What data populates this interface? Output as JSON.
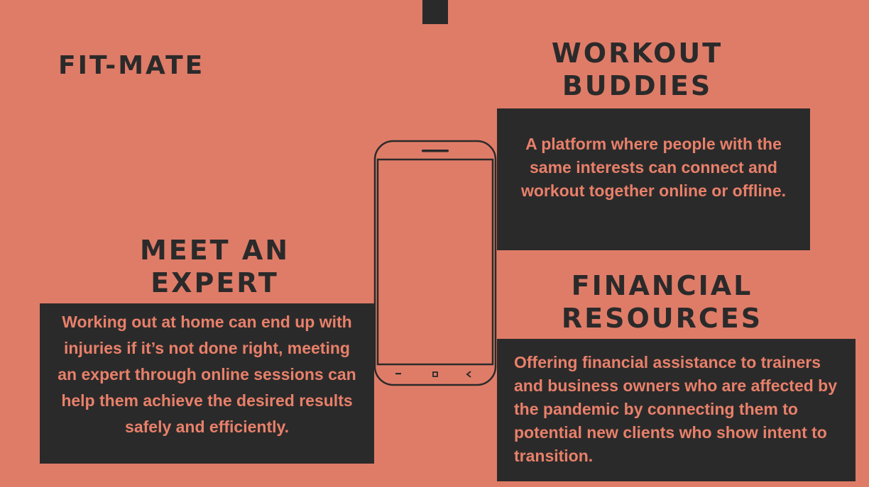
{
  "slide": {
    "background": "#df7c68",
    "dark": "#2b2a2a",
    "accent_text": "#e8806a"
  },
  "brand": {
    "title": "FIT-MATE"
  },
  "sections": {
    "workout": {
      "title": "WORKOUT BUDDIES",
      "body": "A platform where people with the same interests can connect and workout together online or offline."
    },
    "expert": {
      "title": "MEET AN EXPERT",
      "body": "Working out at home can end up with injuries if it’s not done right, meeting an expert through online sessions can help them achieve the desired results safely and efficiently."
    },
    "financial": {
      "title": "FINANCIAL RESOURCES",
      "body": "Offering financial assistance to trainers and business owners  who are affected by the pandemic by connecting them to potential new clients who show intent to transition."
    }
  },
  "icons": {
    "phone": "smartphone-outline-icon",
    "nav_recent": "minus-icon",
    "nav_home": "square-icon",
    "nav_back": "chevron-left-icon"
  }
}
